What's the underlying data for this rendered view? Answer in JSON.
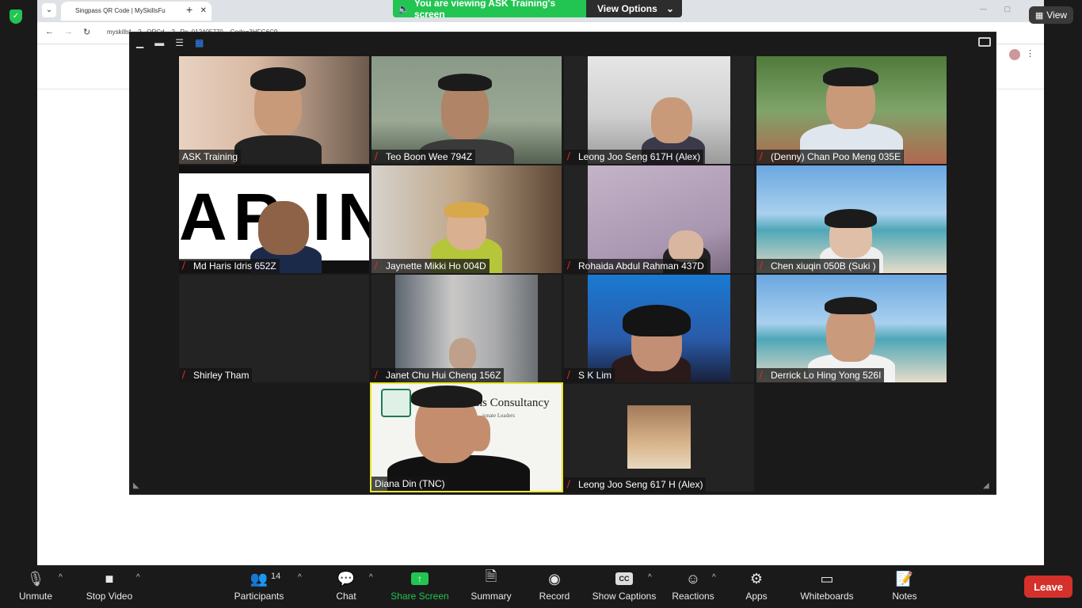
{
  "browser": {
    "tab_title": "Singpass QR Code | MySkillsFu",
    "url": "myskillsf... ?...QRCd... ?...Rc_012405770 ...Code=3HFG6C9"
  },
  "banner": {
    "sharing_text": "You are viewing ASK Training's screen",
    "view_options": "View Options"
  },
  "view_button": "View",
  "participants": [
    {
      "name": "ASK Training",
      "muted": false
    },
    {
      "name": "Teo Boon Wee 794Z",
      "muted": true
    },
    {
      "name": "Leong Joo Seng 617H (Alex)",
      "muted": true
    },
    {
      "name": "(Denny) Chan Poo Meng 035E",
      "muted": true
    },
    {
      "name": "Md Haris Idris 652Z",
      "muted": true
    },
    {
      "name": "Jaynette Mikki Ho 004D",
      "muted": true
    },
    {
      "name": "Rohaida Abdul Rahman 437D",
      "muted": true
    },
    {
      "name": "Chen xiuqin 050B (Suki )",
      "muted": true
    },
    {
      "name": "Shirley Tham",
      "muted": true
    },
    {
      "name": "Janet Chu Hui Cheng 156Z",
      "muted": true
    },
    {
      "name": "S K Lim",
      "muted": true
    },
    {
      "name": "Derrick Lo Hing Yong 526I",
      "muted": true
    },
    {
      "name": "Diana Din (TNC)",
      "muted": false
    },
    {
      "name": "Leong Joo Seng 617 H (Alex)",
      "muted": true
    }
  ],
  "diana_bg_text": {
    "brand": "aidins Consultancy",
    "tagline": "ionate Leaders"
  },
  "toolbar": {
    "unmute": "Unmute",
    "stop_video": "Stop Video",
    "participants": "Participants",
    "participants_count": "14",
    "chat": "Chat",
    "share_screen": "Share Screen",
    "summary": "Summary",
    "record": "Record",
    "show_captions": "Show Captions",
    "captions_icon": "CC",
    "reactions": "Reactions",
    "apps": "Apps",
    "whiteboards": "Whiteboards",
    "notes": "Notes",
    "leave": "Leave"
  },
  "colors": {
    "share_green": "#23c552",
    "leave_red": "#d4312c",
    "active_speaker": "#e8e82a",
    "muted_red": "#e02828"
  }
}
